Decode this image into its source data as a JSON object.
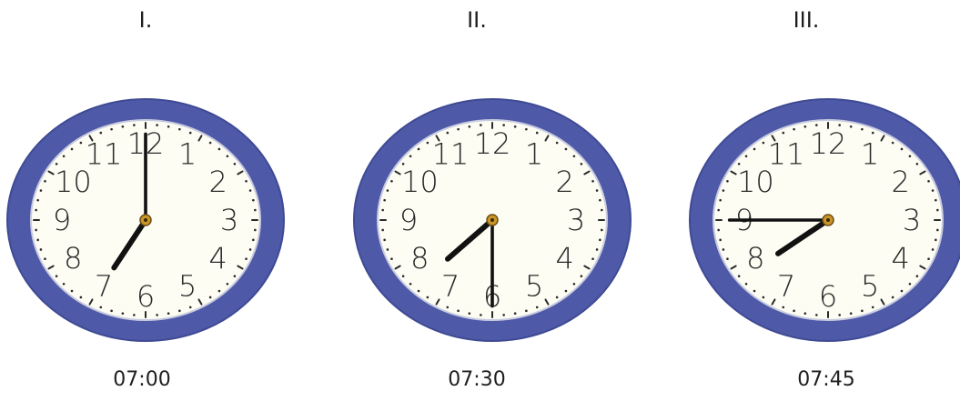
{
  "colors": {
    "rim": "#4e5aa8",
    "rim_edge": "#3f4a94",
    "face": "#fdfdf4",
    "numerals": "#2a2a2a",
    "ticks": "#2a2a2a",
    "hands": "#111111",
    "hub": "#c9962a"
  },
  "numerals": [
    "12",
    "1",
    "2",
    "3",
    "4",
    "5",
    "6",
    "7",
    "8",
    "9",
    "10",
    "11"
  ],
  "clocks": [
    {
      "label": "I.",
      "time": "07:00",
      "hour": 7,
      "minute": 0
    },
    {
      "label": "II.",
      "time": "07:30",
      "hour": 7,
      "minute": 30
    },
    {
      "label": "III.",
      "time": "07:45",
      "hour": 7,
      "minute": 45
    }
  ]
}
